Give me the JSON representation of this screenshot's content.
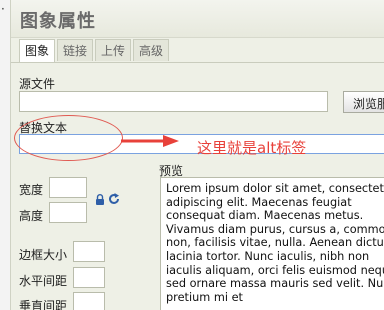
{
  "dialog": {
    "title": "图象属性"
  },
  "tabs": [
    {
      "label": "图象",
      "active": true
    },
    {
      "label": "链接",
      "active": false
    },
    {
      "label": "上传",
      "active": false
    },
    {
      "label": "高级",
      "active": false
    }
  ],
  "fields": {
    "source_label": "源文件",
    "source_value": "",
    "browse_label": "浏览服务",
    "alt_label": "替换文本",
    "alt_value": "",
    "width_label": "宽度",
    "height_label": "高度",
    "border_label": "边框大小",
    "hspace_label": "水平间距",
    "vspace_label": "垂直间距"
  },
  "annotation": {
    "text": "这里就是alt标签",
    "color": "#e8413a"
  },
  "preview": {
    "label": "预览",
    "text": "Lorem ipsum dolor sit amet, consectetuer adipiscing elit. Maecenas feugiat consequat diam. Maecenas metus. Vivamus diam purus, cursus a, commodo non, facilisis vitae, nulla. Aenean dictum lacinia tortor. Nunc iaculis, nibh non iaculis aliquam, orci felis euismod neque, sed ornare massa mauris sed velit. Nulla pretium mi et"
  },
  "icons": {
    "lock": "lock-icon",
    "reset": "reset-size-icon"
  },
  "colors": {
    "dialog_bg": "#eef0e6",
    "highlight_border": "#7aa2e0",
    "annotation_red": "#e8413a"
  }
}
